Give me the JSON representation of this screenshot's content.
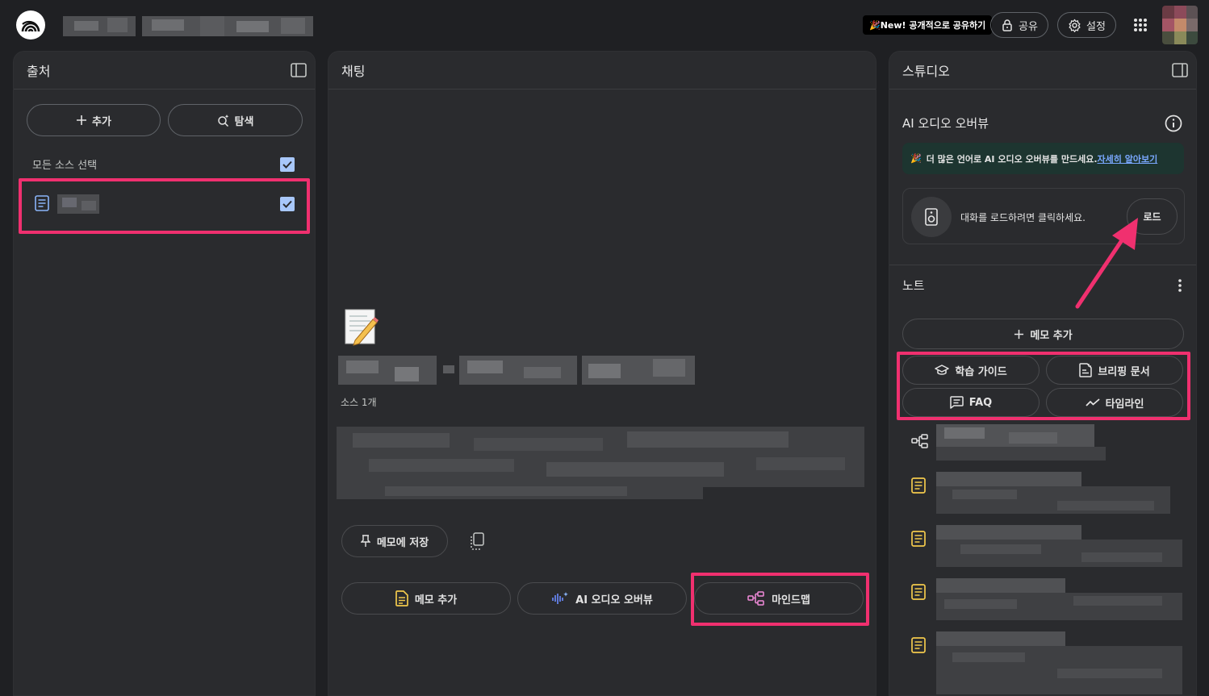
{
  "header": {
    "new_badge": "🎉New! 공개적으로 공유하기",
    "share_label": "공유",
    "settings_label": "설정"
  },
  "sources": {
    "title": "출처",
    "add_label": "추가",
    "explore_label": "탐색",
    "select_all_label": "모든 소스 선택"
  },
  "chat": {
    "title": "채팅",
    "source_count": "소스 1개",
    "save_to_note_label": "메모에 저장",
    "actions": {
      "add_note": "메모 추가",
      "audio_overview": "AI 오디오 오버뷰",
      "mind_map": "마인드맵"
    }
  },
  "studio": {
    "title": "스튜디오",
    "audio_overview_title": "AI 오디오 오버뷰",
    "banner_text": "더 많은 언어로 AI 오디오 오버뷰를 만드세요.",
    "banner_link": "자세히 알아보기",
    "load_prompt": "대화를 로드하려면 클릭하세요.",
    "load_label": "로드",
    "notes_title": "노트",
    "add_note_label": "메모 추가",
    "study_guide_label": "학습 가이드",
    "briefing_label": "브리핑 문서",
    "faq_label": "FAQ",
    "timeline_label": "타임라인"
  },
  "colors": {
    "highlight": "#f0306f",
    "accent_blue": "#a8c7fa",
    "note_icon": "#f2c94c",
    "mindmap_icon": "#f28bda"
  }
}
